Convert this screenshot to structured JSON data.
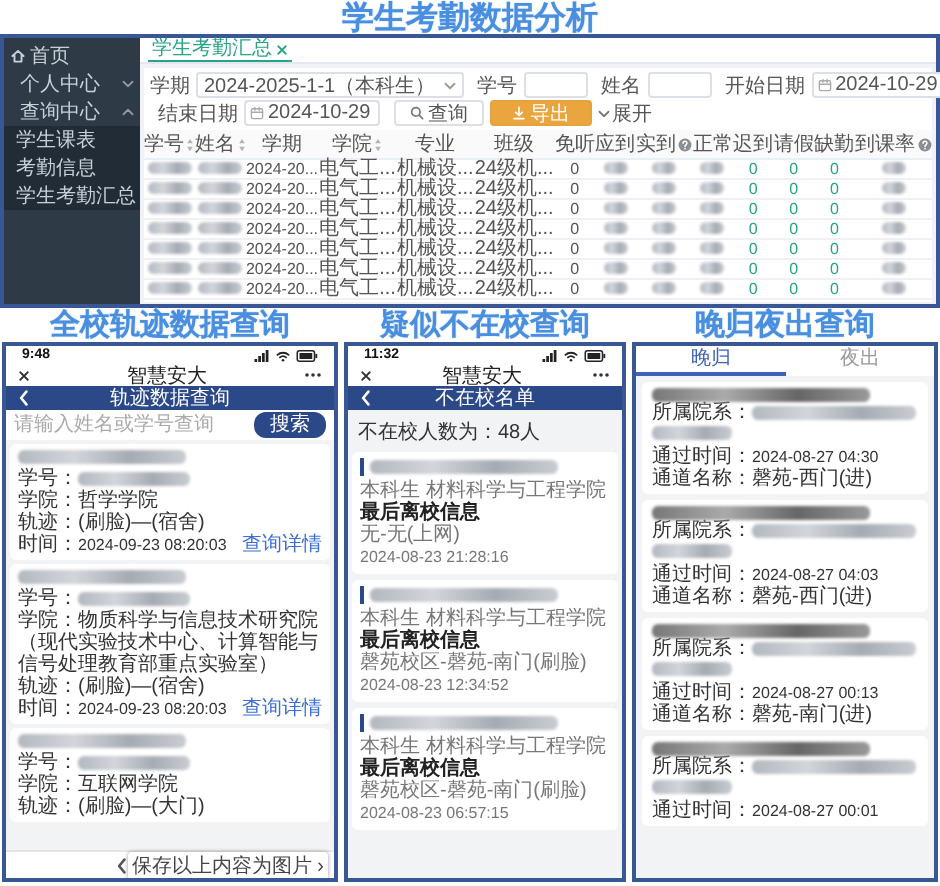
{
  "attendance": {
    "heading": "学生考勤数据分析",
    "sidebar": {
      "items": [
        {
          "label": "首页",
          "kind": "home"
        },
        {
          "label": "个人中心",
          "kind": "group",
          "expanded": false
        },
        {
          "label": "查询中心",
          "kind": "group",
          "expanded": true,
          "children": [
            {
              "label": "学生课表"
            },
            {
              "label": "考勤信息"
            },
            {
              "label": "学生考勤汇总"
            }
          ]
        }
      ]
    },
    "tabs": [
      {
        "label": "学生考勤汇总",
        "selected": true
      }
    ],
    "filter_rows": [
      [
        {
          "kind": "select",
          "label": "学期",
          "value": "2024-2025-1-1（本科生）"
        },
        {
          "kind": "input",
          "label": "学号"
        },
        {
          "kind": "input",
          "label": "姓名"
        },
        {
          "kind": "date",
          "label": "开始日期",
          "value": "2024-10-29"
        }
      ],
      [
        {
          "kind": "date",
          "label": "结束日期",
          "value": "2024-10-29"
        },
        {
          "kind": "search_button",
          "label": "查询"
        },
        {
          "kind": "export_button",
          "label": "导出"
        },
        {
          "kind": "expand_link",
          "label": "展开"
        }
      ]
    ],
    "table": {
      "columns": [
        {
          "label": "学号",
          "sortable": true,
          "help": false,
          "highlight": false
        },
        {
          "label": "姓名",
          "sortable": true,
          "help": false,
          "highlight": false
        },
        {
          "label": "学期",
          "sortable": false,
          "help": false,
          "highlight": false
        },
        {
          "label": "学院",
          "sortable": true,
          "help": false,
          "highlight": false
        },
        {
          "label": "专业",
          "sortable": false,
          "help": false,
          "highlight": false
        },
        {
          "label": "班级",
          "sortable": false,
          "help": false,
          "highlight": false
        },
        {
          "label": "免听",
          "sortable": false,
          "help": false,
          "highlight": false
        },
        {
          "label": "应到",
          "sortable": false,
          "help": false,
          "highlight": false
        },
        {
          "label": "实到",
          "sortable": false,
          "help": true,
          "highlight": false
        },
        {
          "label": "正常",
          "sortable": false,
          "help": false,
          "highlight": false
        },
        {
          "label": "迟到",
          "sortable": false,
          "help": false,
          "highlight": true
        },
        {
          "label": "请假",
          "sortable": false,
          "help": false,
          "highlight": true
        },
        {
          "label": "缺勤",
          "sortable": false,
          "help": false,
          "highlight": true
        },
        {
          "label": "到课率",
          "sortable": false,
          "help": true,
          "highlight": false
        }
      ],
      "rows": [
        {
          "cells": [
            "",
            "",
            "2024-20...",
            "电气工...",
            "机械设...",
            "24级机...",
            "0",
            "",
            "",
            "",
            "0",
            "0",
            "0",
            ""
          ]
        },
        {
          "cells": [
            "",
            "",
            "2024-20...",
            "电气工...",
            "机械设...",
            "24级机...",
            "0",
            "",
            "",
            "",
            "0",
            "0",
            "0",
            ""
          ]
        },
        {
          "cells": [
            "",
            "",
            "2024-20...",
            "电气工...",
            "机械设...",
            "24级机...",
            "0",
            "",
            "",
            "",
            "0",
            "0",
            "0",
            ""
          ]
        },
        {
          "cells": [
            "",
            "",
            "2024-20...",
            "电气工...",
            "机械设...",
            "24级机...",
            "0",
            "",
            "",
            "",
            "0",
            "0",
            "0",
            ""
          ]
        },
        {
          "cells": [
            "",
            "",
            "2024-20...",
            "电气工...",
            "机械设...",
            "24级机...",
            "0",
            "",
            "",
            "",
            "0",
            "0",
            "0",
            ""
          ]
        },
        {
          "cells": [
            "",
            "",
            "2024-20...",
            "电气工...",
            "机械设...",
            "24级机...",
            "0",
            "",
            "",
            "",
            "0",
            "0",
            "0",
            ""
          ]
        },
        {
          "cells": [
            "",
            "",
            "2024-20...",
            "电气工...",
            "机械设...",
            "24级机...",
            "0",
            "",
            "",
            "",
            "0",
            "0",
            "0",
            ""
          ]
        }
      ]
    }
  },
  "track": {
    "heading": "全校轨迹数据查询",
    "status_time": "9:48",
    "app_title": "智慧安大",
    "page_title": "轨迹数据查询",
    "search": {
      "placeholder": "请输入姓名或学号查询",
      "button": "搜索"
    },
    "records": [
      {
        "lines": [
          {
            "label": "学号：",
            "redacted": true
          },
          {
            "label": "学院：",
            "value": "哲学学院",
            "redacted": false
          },
          {
            "label": "轨迹：",
            "value": "(刷脸)—(宿舍)",
            "redacted": false
          },
          {
            "label": "时间：",
            "value": "2024-09-23 08:20:03",
            "redacted": false,
            "link": "查询详情"
          }
        ]
      },
      {
        "lines": [
          {
            "label": "学号：",
            "redacted": true
          },
          {
            "label": "学院：",
            "value": "物质科学与信息技术研究院（现代实验技术中心、计算智能与信号处理教育部重点实验室）",
            "redacted": false
          },
          {
            "label": "轨迹：",
            "value": "(刷脸)—(宿舍)",
            "redacted": false
          },
          {
            "label": "时间：",
            "value": "2024-09-23 08:20:03",
            "redacted": false,
            "link": "查询详情"
          }
        ]
      },
      {
        "lines": [
          {
            "label": "学号：",
            "redacted": true
          },
          {
            "label": "学院：",
            "value": "互联网学院",
            "redacted": false
          },
          {
            "label": "轨迹：",
            "value": "(刷脸)—(大门)",
            "redacted": false
          }
        ]
      }
    ],
    "save_hint": "保存以上内容为图片 ›"
  },
  "absent": {
    "heading": "疑似不在校查询",
    "status_time": "11:32",
    "app_title": "智慧安大",
    "page_title": "不在校名单",
    "count": "不在校人数为：48人",
    "records": [
      {
        "program": "本科生 材料科学与工程学院",
        "section": "最后离校信息",
        "location": "无-无(上网)",
        "time": "2024-08-23 21:28:16"
      },
      {
        "program": "本科生 材料科学与工程学院",
        "section": "最后离校信息",
        "location": "磬苑校区-磬苑-南门(刷脸)",
        "time": "2024-08-23 12:34:52"
      },
      {
        "program": "本科生 材料科学与工程学院",
        "section": "最后离校信息",
        "location": "磬苑校区-磬苑-南门(刷脸)",
        "time": "2024-08-23 06:57:15"
      }
    ]
  },
  "late": {
    "heading": "晚归夜出查询",
    "tabs": [
      {
        "label": "晚归",
        "selected": true
      },
      {
        "label": "夜出",
        "selected": false
      }
    ],
    "records": [
      {
        "lines": [
          {
            "label": "所属院系：",
            "redacted": true
          },
          {
            "label": "通过时间：",
            "value": "2024-08-27 04:30",
            "redacted": false
          },
          {
            "label": "通道名称：",
            "value": "磬苑-西门(进)",
            "redacted": false
          }
        ]
      },
      {
        "lines": [
          {
            "label": "所属院系：",
            "redacted": true
          },
          {
            "label": "通过时间：",
            "value": "2024-08-27 04:03",
            "redacted": false
          },
          {
            "label": "通道名称：",
            "value": "磬苑-西门(进)",
            "redacted": false
          }
        ]
      },
      {
        "lines": [
          {
            "label": "所属院系：",
            "redacted": true
          },
          {
            "label": "通过时间：",
            "value": "2024-08-27 00:13",
            "redacted": false
          },
          {
            "label": "通道名称：",
            "value": "磬苑-南门(进)",
            "redacted": false
          }
        ]
      },
      {
        "lines": [
          {
            "label": "所属院系：",
            "redacted": true
          },
          {
            "label": "通过时间：",
            "value": "2024-08-27 00:01",
            "redacted": false
          }
        ]
      }
    ]
  }
}
